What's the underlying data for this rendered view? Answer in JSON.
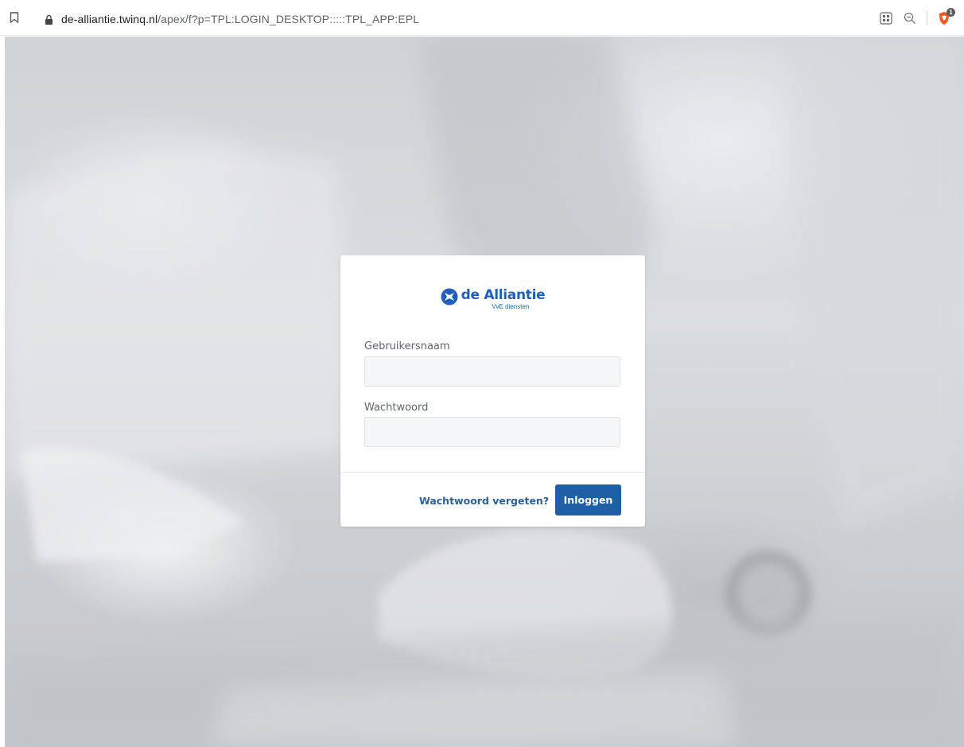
{
  "browser": {
    "url_host": "de-alliantie.twinq.nl",
    "url_path": "/apex/f?p=TPL:LOGIN_DESKTOP:::::TPL_APP:EPL",
    "icons": [
      "bookmark-icon",
      "lock-icon",
      "qr-code-icon",
      "zoom-out-icon",
      "brave-shield-icon"
    ],
    "shield_badge": "1"
  },
  "login": {
    "logo_title": "de Alliantie",
    "logo_subtitle": "VvE diensten",
    "username_label": "Gebruikersnaam",
    "username_value": "",
    "password_label": "Wachtwoord",
    "password_value": "",
    "forgot_link": "Wachtwoord vergeten?",
    "submit_label": "Inloggen"
  },
  "colors": {
    "brand_blue": "#1f5fbf",
    "button_blue": "#1f5fa6",
    "link_blue": "#2d5f98"
  }
}
